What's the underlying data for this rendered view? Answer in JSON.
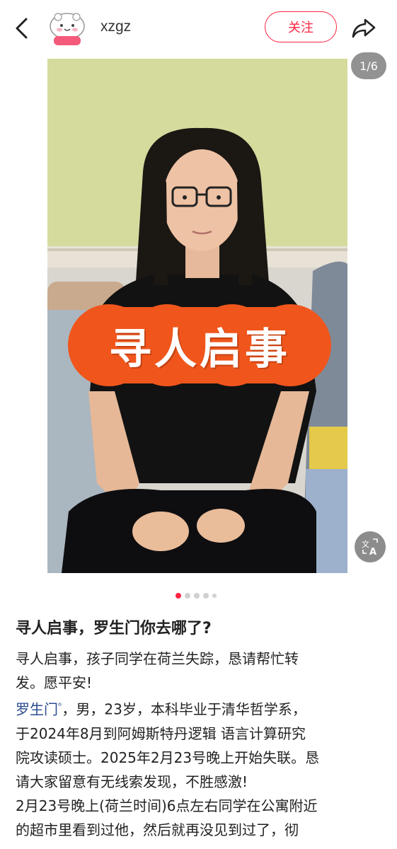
{
  "header": {
    "username": "xzgz",
    "follow_label": "关注"
  },
  "photo": {
    "page_counter": "1/6",
    "banner_text": "寻人启事",
    "current_index": 1,
    "total": 6
  },
  "post": {
    "title": "寻人启事，罗生门你去哪了?",
    "line1": "寻人启事，孩子同学在荷兰失踪，恳请帮忙转",
    "line2": "发。愿平安!",
    "mention": "罗生门",
    "line3_rest": "，男，23岁，本科毕业于清华哲学系，",
    "line4": "于2024年8月到阿姆斯特丹逻辑 语言计算研究",
    "line5": "院攻读硕士。2025年2月23号晚上开始失联。恳",
    "line6": "请大家留意有无线索发现，不胜感激!",
    "line7": "2月23号晚上(荷兰时间)6点左右同学在公寓附近",
    "line8": "的超市里看到过他，然后就再没见到过了，彻"
  },
  "colors": {
    "accent": "#ff2442",
    "mention": "#2b4a8f",
    "banner": "#f0561c"
  },
  "icons": [
    "back-arrow-icon",
    "share-icon",
    "translate-icon",
    "search-mention-icon"
  ]
}
